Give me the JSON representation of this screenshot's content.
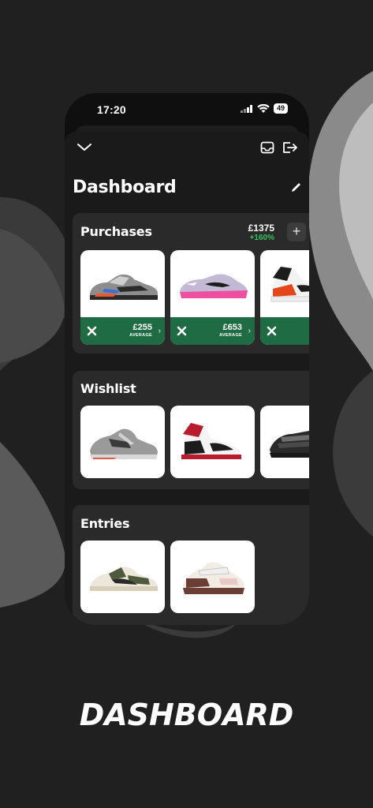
{
  "colors": {
    "background": "#202020",
    "sheet": "#1a1a1a",
    "section": "#2a2a2a",
    "card_footer": "#1f6b43",
    "positive": "#35c25c"
  },
  "status_bar": {
    "time": "17:20",
    "battery": "49",
    "icons": [
      "signal-icon",
      "wifi-icon",
      "battery-icon"
    ]
  },
  "toolbar": {
    "icons": [
      "chevron-down-icon",
      "inbox-icon",
      "logout-icon",
      "edit-icon"
    ]
  },
  "page": {
    "title": "Dashboard"
  },
  "purchases": {
    "title": "Purchases",
    "total": "£1375",
    "change": "+160%",
    "add_label": "+",
    "items": [
      {
        "name": "yeezy-700-wave-runner",
        "price": "£255",
        "label": "AVERAGE"
      },
      {
        "name": "off-white-air-max-97-pink",
        "price": "£653",
        "label": "AVERAGE"
      },
      {
        "name": "jordan-1-orange",
        "price": "",
        "label": ""
      }
    ]
  },
  "wishlist": {
    "title": "Wishlist",
    "items": [
      {
        "name": "asics-gel-kayano-grey"
      },
      {
        "name": "jordan-1-black-toe"
      },
      {
        "name": "air-max-95-black"
      }
    ]
  },
  "entries": {
    "title": "Entries",
    "items": [
      {
        "name": "travis-scott-dunk-low-olive"
      },
      {
        "name": "jordan-brown-strap-sneaker"
      }
    ]
  },
  "footer": {
    "text": "DASHBOARD"
  }
}
